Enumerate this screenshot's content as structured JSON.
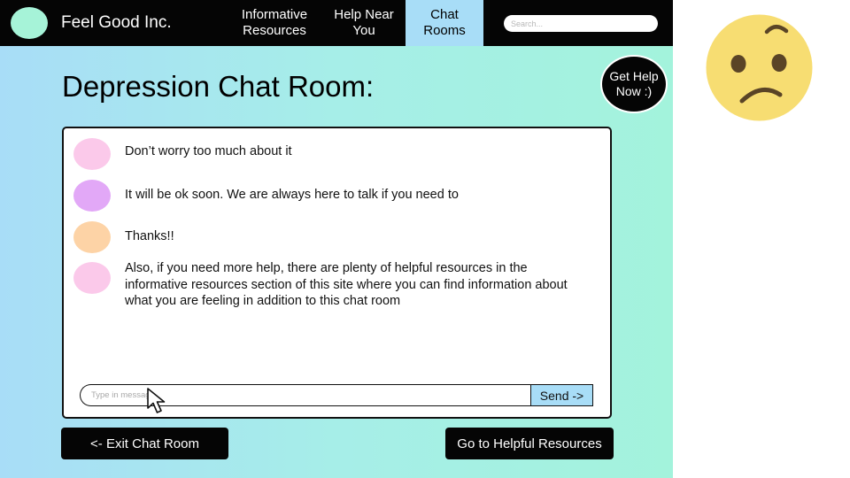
{
  "header": {
    "brand": "Feel Good Inc.",
    "nav": [
      {
        "label_line1": "Informative",
        "label_line2": "Resources",
        "active": false
      },
      {
        "label_line1": "Help Near",
        "label_line2": "You",
        "active": false
      },
      {
        "label_line1": "Chat",
        "label_line2": "Rooms",
        "active": true
      }
    ],
    "search_placeholder": "Search..."
  },
  "help_button": {
    "line1": "Get Help",
    "line2": "Now :)"
  },
  "page_title": "Depression Chat Room:",
  "messages": [
    {
      "avatar_color": "#fbc9ea",
      "text": "Don’t worry too much about it"
    },
    {
      "avatar_color": "#e2a8f7",
      "text": "It will be ok soon. We are always here to talk if you need to"
    },
    {
      "avatar_color": "#fdd3a6",
      "text": "Thanks!!"
    },
    {
      "avatar_color": "#fbc9ea",
      "text": "Also, if you need more help, there are plenty of helpful resources in the informative resources section of this site where you can find information about what you are feeling in addition to this chat room"
    }
  ],
  "composer": {
    "placeholder": "Type in message",
    "send_label": "Send ->"
  },
  "buttons": {
    "exit_label": "<-  Exit Chat Room",
    "resources_label": "Go to Helpful Resources"
  },
  "colors": {
    "navbar": "#050505",
    "accent": "#a8ddf7",
    "logo": "#a6f3d8",
    "emoji": "#f7dd72"
  },
  "icons": {
    "cursor": "mouse-pointer-icon",
    "emoji": "worried-face-icon"
  }
}
